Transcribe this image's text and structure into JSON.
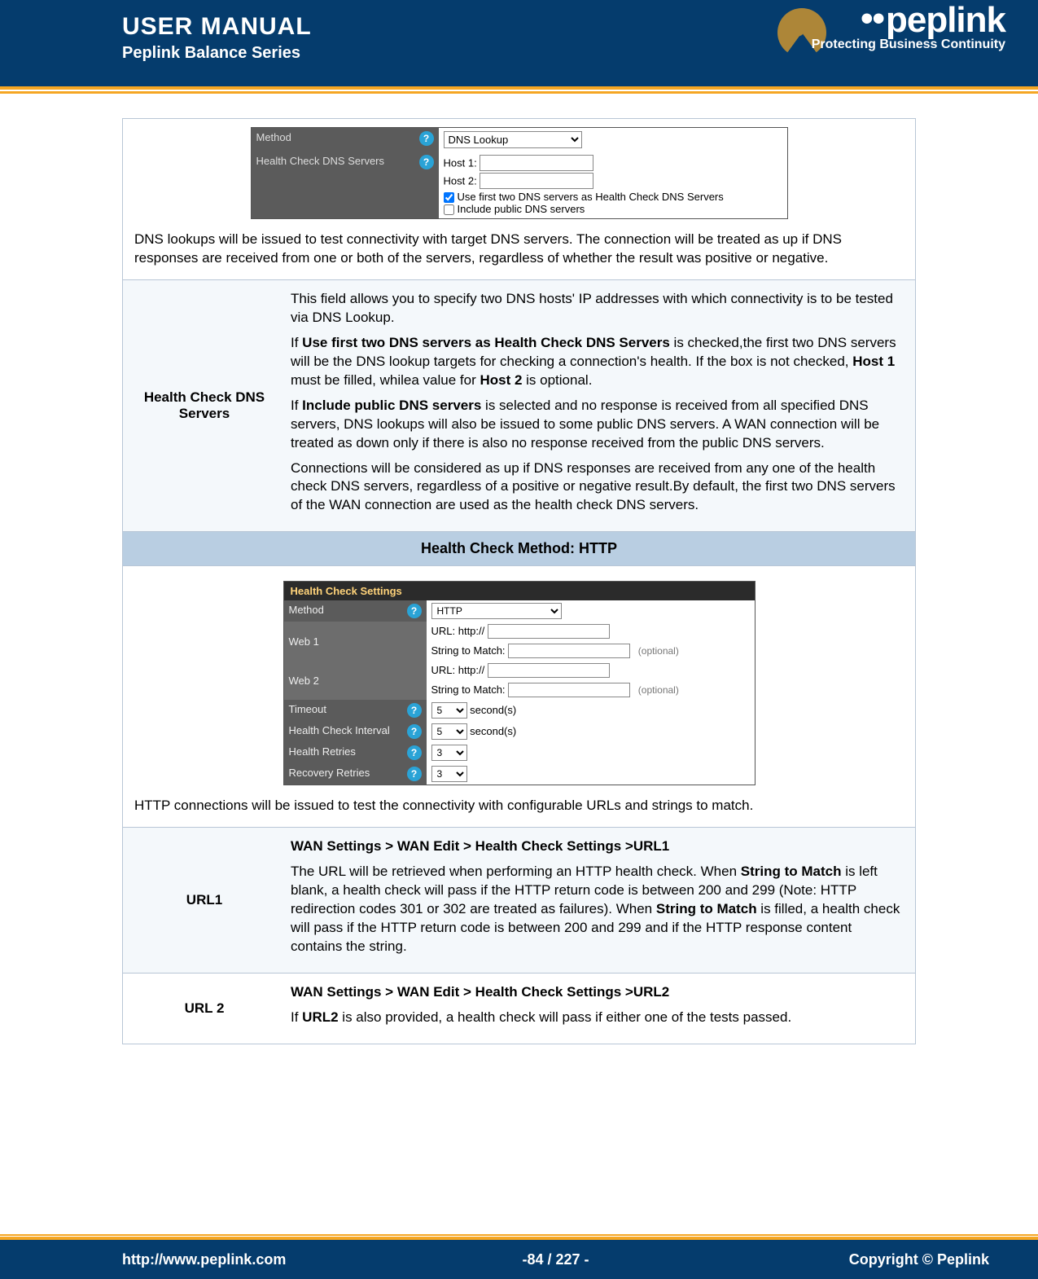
{
  "header": {
    "title": "USER MANUAL",
    "subtitle": "Peplink Balance Series",
    "brand": "peplink",
    "tagline": "Protecting Business Continuity"
  },
  "fig_dns": {
    "method_label": "Method",
    "method_value": "DNS Lookup",
    "servers_label": "Health Check DNS Servers",
    "host1_label": "Host 1:",
    "host2_label": "Host 2:",
    "cb1_label": "Use first two DNS servers as Health Check DNS Servers",
    "cb2_label": "Include public DNS servers"
  },
  "dns_caption": "DNS lookups will be issued to test connectivity with target DNS servers. The connection will be treated as up if DNS responses are received from one or both of the servers, regardless of whether the result was positive or negative.",
  "hc_dns": {
    "label": "Health Check DNS Servers",
    "p1": "This field allows you to specify two DNS hosts' IP addresses with which connectivity is to be tested via DNS Lookup.",
    "p2a": "If ",
    "p2b": "Use first two DNS servers as Health Check DNS Servers",
    "p2c": " is checked,the first two DNS servers will be the DNS lookup targets for checking a connection's health. If the box is not checked, ",
    "p2d": "Host 1",
    "p2e": " must be filled, whilea value for ",
    "p2f": "Host 2",
    "p2g": " is optional.",
    "p3a": "If ",
    "p3b": "Include public DNS servers",
    "p3c": " is selected and no response is received from all specified DNS servers, DNS lookups will also be issued to some public DNS servers. A WAN connection will be treated as down only if there is also no response received from the public DNS servers.",
    "p4": "Connections will be considered as up if DNS responses are received from any one of the health check DNS servers, regardless of a positive or negative result.By default, the first two DNS servers of the WAN connection are used as the health check DNS servers."
  },
  "section_http": "Health Check Method: HTTP",
  "fig_http": {
    "panel_title": "Health Check Settings",
    "method_label": "Method",
    "method_value": "HTTP",
    "web1_label": "Web 1",
    "web2_label": "Web 2",
    "url_prefix": "URL: http://",
    "string_label": "String to Match:",
    "optional": "(optional)",
    "timeout_label": "Timeout",
    "timeout_val": "5",
    "seconds": "second(s)",
    "interval_label": "Health Check Interval",
    "interval_val": "5",
    "hretries_label": "Health Retries",
    "hretries_val": "3",
    "rretries_label": "Recovery Retries",
    "rretries_val": "3"
  },
  "http_caption": "HTTP connections will be issued to test the connectivity with configurable URLs and strings to match.",
  "url1": {
    "label": "URL1",
    "path": "WAN Settings > WAN Edit > Health Check Settings >URL1",
    "b1a": "The URL will be retrieved when performing an HTTP health check. When ",
    "b1b": "String to Match",
    "b1c": " is left blank, a health check will pass if the HTTP return code is between 200 and 299 (Note: HTTP redirection codes 301 or 302 are treated as failures). When ",
    "b1d": "String to Match",
    "b1e": " is filled, a health check will pass if the HTTP return code is between 200 and 299 and if the HTTP response content contains the string."
  },
  "url2": {
    "label": "URL 2",
    "path": "WAN Settings > WAN Edit > Health Check Settings >URL2",
    "b1a": "If ",
    "b1b": "URL2",
    "b1c": " is also provided, a health check will pass if either one of the tests passed."
  },
  "footer": {
    "left": "http://www.peplink.com",
    "center": "-84 / 227 -",
    "right": "Copyright ©  Peplink"
  }
}
